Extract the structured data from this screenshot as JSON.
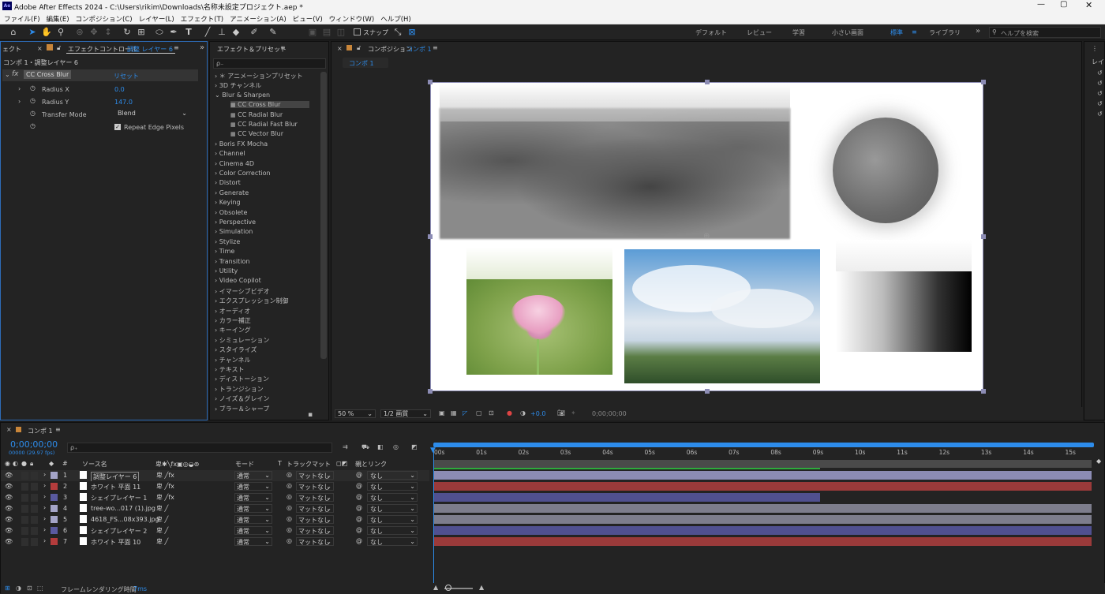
{
  "app": {
    "title": "Adobe After Effects 2024 - C:\\Users\\rikim\\Downloads\\名称未設定プロジェクト.aep *",
    "logo": "Ae"
  },
  "menu": [
    "ファイル(F)",
    "編集(E)",
    "コンポジション(C)",
    "レイヤー(L)",
    "エフェクト(T)",
    "アニメーション(A)",
    "ビュー(V)",
    "ウィンドウ(W)",
    "ヘルプ(H)"
  ],
  "toolbar": {
    "snap_label": "スナップ",
    "workspaces": [
      "デフォルト",
      "レビュー",
      "学習",
      "小さい画面",
      "標準",
      "ライブラリ"
    ],
    "active_workspace": "標準",
    "help_placeholder": "ヘルプを検索"
  },
  "effect_controls": {
    "tab_left": "ェクト",
    "tab_label": "エフェクトコントロール",
    "tab_layer": "調整 レイヤー 6",
    "breadcrumb": "コンポ 1・調整レイヤー 6",
    "effect_name": "CC Cross Blur",
    "reset": "リセット",
    "params": [
      {
        "name": "Radius X",
        "value": "0.0"
      },
      {
        "name": "Radius Y",
        "value": "147.0"
      },
      {
        "name": "Transfer Mode",
        "value": "Blend"
      }
    ],
    "checkbox_label": "Repeat Edge Pixels"
  },
  "effects_presets": {
    "tab_label": "エフェクト＆プリセット",
    "search_placeholder": "ρ₋",
    "items": [
      "＊ アニメーションプリセット",
      "3D チャンネル",
      "Blur & Sharpen"
    ],
    "sub_items": [
      "CC Cross Blur",
      "CC Radial Blur",
      "CC Radial Fast Blur",
      "CC Vector Blur"
    ],
    "categories": [
      "Boris FX Mocha",
      "Channel",
      "Cinema 4D",
      "Color Correction",
      "Distort",
      "Generate",
      "Keying",
      "Obsolete",
      "Perspective",
      "Simulation",
      "Stylize",
      "Time",
      "Transition",
      "Utility",
      "Video Copilot",
      "イマーシブビデオ",
      "エクスプレッション制御",
      "オーディオ",
      "カラー補正",
      "キーイング",
      "シミュレーション",
      "スタイライズ",
      "チャンネル",
      "テキスト",
      "ディストーション",
      "トランジション",
      "ノイズ＆グレイン",
      "ブラー＆シャープ"
    ]
  },
  "composition": {
    "tab_label": "コンポジション",
    "tab_comp": "コンポ 1",
    "subtab": "コンポ 1",
    "zoom": "50 %",
    "quality": "1/2 画質",
    "exposure": "+0.0",
    "timecode": "0;00;00;00"
  },
  "timeline": {
    "tab_label": "コンポ 1",
    "timecode": "0;00;00;00",
    "fps": "00000 (29.97 fps)",
    "search_placeholder": "ρ₊",
    "headers": {
      "source": "ソース名",
      "mode": "モード",
      "t": "T",
      "trackmatte": "トラックマット",
      "parent": "親とリンク"
    },
    "ruler": [
      "00s",
      "01s",
      "02s",
      "03s",
      "04s",
      "05s",
      "06s",
      "07s",
      "08s",
      "09s",
      "10s",
      "11s",
      "12s",
      "13s",
      "14s",
      "15s"
    ],
    "layers": [
      {
        "num": "1",
        "name": "調整レイヤー 6",
        "mode": "通常",
        "matte": "マットなし",
        "parent": "なし",
        "label": "#a4a4c8",
        "bar": "#8c8cb4"
      },
      {
        "num": "2",
        "name": "ホワイト 平面 11",
        "mode": "通常",
        "matte": "マットなし",
        "parent": "なし",
        "label": "#b43c3c",
        "bar": "#9a3a3a"
      },
      {
        "num": "3",
        "name": "シェイプレイヤー 1",
        "mode": "通常",
        "matte": "マットなし",
        "parent": "なし",
        "label": "#5a5aa0",
        "bar": "#505090"
      },
      {
        "num": "4",
        "name": "tree-wo...017 (1).jpg",
        "mode": "通常",
        "matte": "マットなし",
        "parent": "なし",
        "label": "#a4a4c8",
        "bar": "#7d7d8c"
      },
      {
        "num": "5",
        "name": "4618_FS...08x393.jpg",
        "mode": "通常",
        "matte": "マットなし",
        "parent": "なし",
        "label": "#a4a4c8",
        "bar": "#7d7d8c"
      },
      {
        "num": "6",
        "name": "シェイプレイヤー 2",
        "mode": "通常",
        "matte": "マットなし",
        "parent": "なし",
        "label": "#5a5aa0",
        "bar": "#505090"
      },
      {
        "num": "7",
        "name": "ホワイト 平面 10",
        "mode": "通常",
        "matte": "マットなし",
        "parent": "なし",
        "label": "#b43c3c",
        "bar": "#9a3a3a"
      }
    ],
    "footer_label": "フレームレンダリング時間",
    "footer_value": "7ms"
  }
}
